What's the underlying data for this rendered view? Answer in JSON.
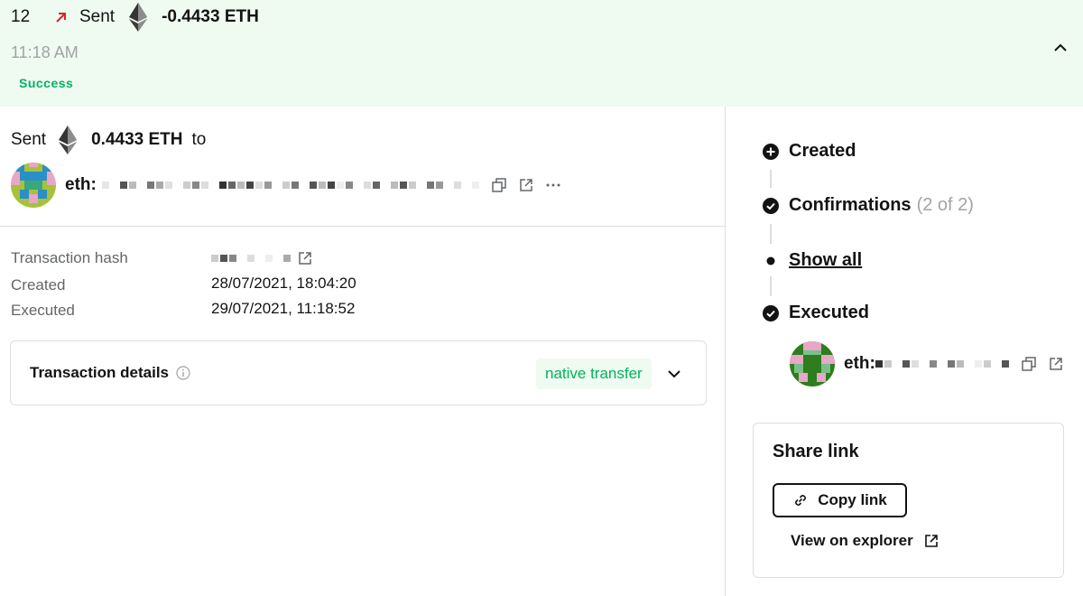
{
  "summary": {
    "nonce": "12",
    "type": "Sent",
    "amount": "-0.4433 ETH",
    "time": "11:18 AM",
    "status": "Success",
    "status_color": "#00b460",
    "direction_icon": "arrow-up-right-icon",
    "collapse_icon": "chevron-up-icon"
  },
  "transfer": {
    "label": "Sent",
    "amount": "0.4433 ETH",
    "to_label": "to",
    "recipient_prefix": "eth:"
  },
  "details": {
    "hash_label": "Transaction hash",
    "created_label": "Created",
    "created_value": "28/07/2021, 18:04:20",
    "executed_label": "Executed",
    "executed_value": "29/07/2021, 11:18:52"
  },
  "tx_details": {
    "title": "Transaction details",
    "badge": "native transfer"
  },
  "timeline": {
    "created": "Created",
    "confirmations": "Confirmations",
    "confirmations_count": "(2 of 2)",
    "show_all": "Show all",
    "executed": "Executed",
    "executor_prefix": "eth:"
  },
  "share": {
    "title": "Share link",
    "copy_label": "Copy link",
    "explorer_label": "View on explorer"
  },
  "colors": {
    "accent_green": "#00b460",
    "header_bg": "#effaf1",
    "danger_arrow": "#ff5f72"
  }
}
